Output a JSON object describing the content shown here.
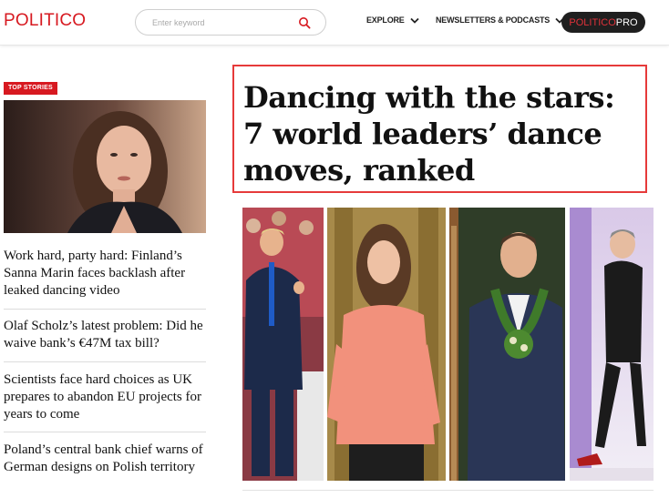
{
  "header": {
    "logo": "POLITICO",
    "search_placeholder": "Enter keyword",
    "nav": {
      "explore": "EXPLORE",
      "newsletters": "NEWSLETTERS & PODCASTS"
    },
    "pro_button": {
      "part1": "POLITICO",
      "part2": "PRO"
    }
  },
  "left_column": {
    "tag": "TOP STORIES",
    "stories": [
      "Work hard, party hard: Finland’s Sanna Marin faces backlash after leaked dancing video",
      "Olaf Scholz’s latest problem: Did he waive bank’s €47M tax bill?",
      "Scientists face hard choices as UK prepares to abandon EU projects for years to come",
      "Poland’s central bank chief warns of German designs on Polish territory"
    ]
  },
  "main": {
    "headline": "Dancing with the stars: 7 world leaders’ dance moves, ranked"
  },
  "colors": {
    "brand_red": "#d71920",
    "highlight_border": "#e63a3a",
    "pro_dark": "#1f1f1f"
  }
}
